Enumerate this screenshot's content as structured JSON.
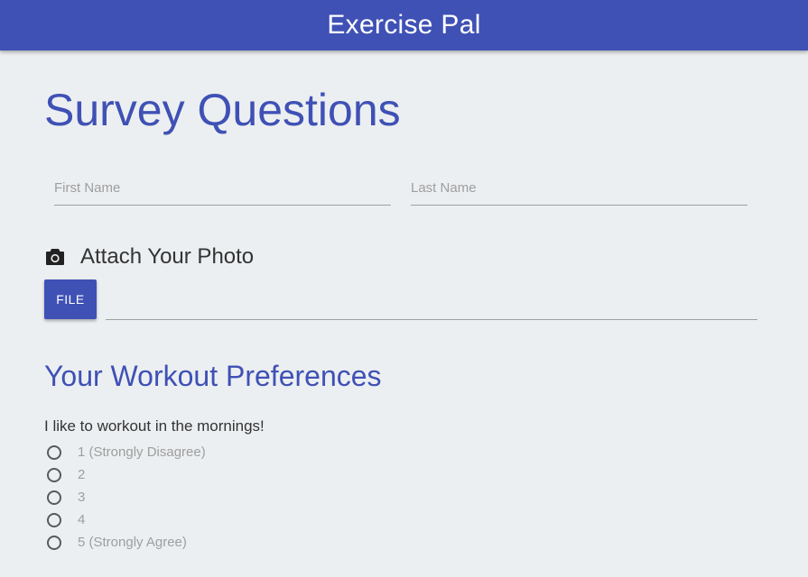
{
  "app_bar": {
    "title": "Exercise Pal"
  },
  "page": {
    "title": "Survey Questions"
  },
  "form": {
    "first_name": {
      "placeholder": "First Name",
      "value": ""
    },
    "last_name": {
      "placeholder": "Last Name",
      "value": ""
    },
    "attach": {
      "icon": "camera-icon",
      "label": "Attach Your Photo",
      "button_label": "FILE",
      "file_path": ""
    }
  },
  "preferences": {
    "title": "Your Workout Preferences",
    "question": "I like to workout in the mornings!",
    "options": [
      {
        "label": "1 (Strongly Disagree)",
        "selected": false
      },
      {
        "label": "2",
        "selected": false
      },
      {
        "label": "3",
        "selected": false
      },
      {
        "label": "4",
        "selected": false
      },
      {
        "label": "5 (Strongly Agree)",
        "selected": false
      }
    ]
  },
  "colors": {
    "primary": "#3f51b5",
    "background": "#eceff1",
    "text": "#333333",
    "muted": "#9e9e9e"
  }
}
